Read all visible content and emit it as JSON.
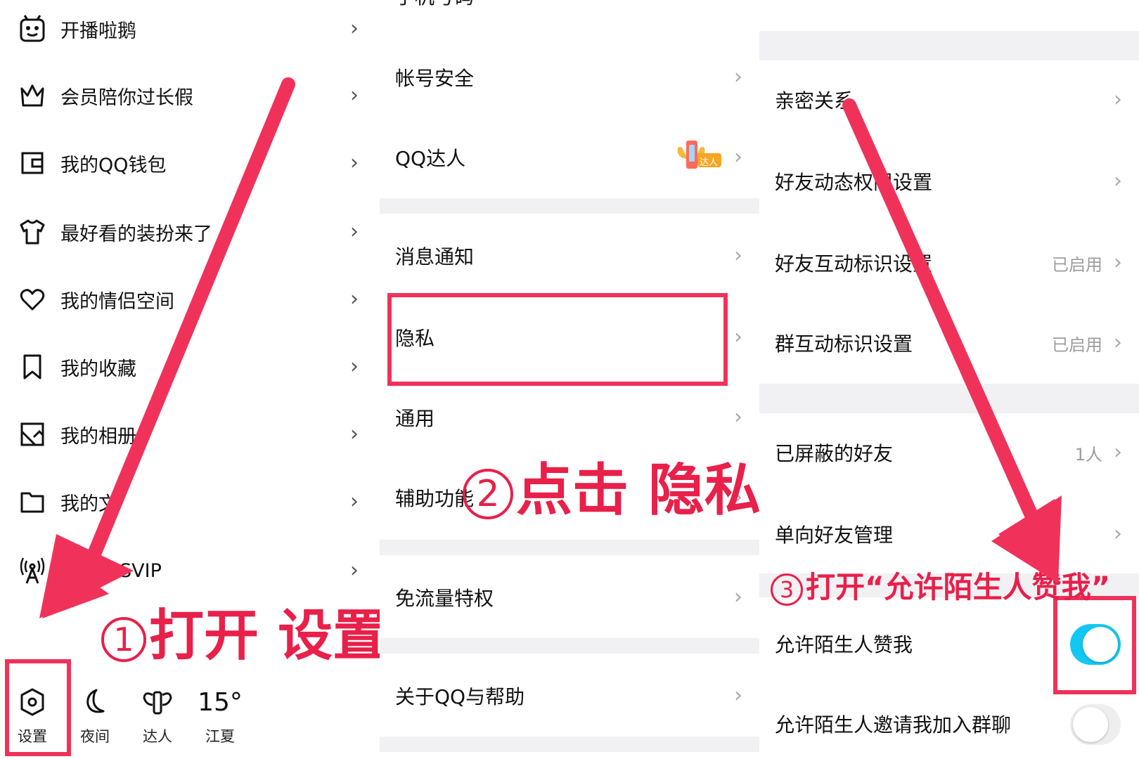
{
  "panel1": {
    "menu": [
      {
        "label": "开播啦鹅",
        "icon": "tv-mascot-icon"
      },
      {
        "label": "会员陪你过长假",
        "icon": "crown-icon"
      },
      {
        "label": "我的QQ钱包",
        "icon": "wallet-icon"
      },
      {
        "label": "最好看的装扮来了",
        "icon": "tshirt-icon"
      },
      {
        "label": "我的情侣空间",
        "icon": "heart-icon"
      },
      {
        "label": "我的收藏",
        "icon": "bookmark-icon"
      },
      {
        "label": "我的相册",
        "icon": "photo-icon"
      },
      {
        "label": "我的文",
        "icon": "folder-icon"
      },
      {
        "label": "SVIP",
        "icon": "broadcast-icon"
      }
    ],
    "bottom": [
      {
        "label": "设置",
        "icon": "settings-hex-icon"
      },
      {
        "label": "夜间",
        "icon": "moon-icon"
      },
      {
        "label": "达人",
        "icon": "wings-icon"
      },
      {
        "label": "江夏",
        "temp": "15°",
        "icon": "weather-text"
      }
    ],
    "annotation": {
      "num": "1",
      "text": "打开 设置"
    }
  },
  "panel2": {
    "top_cut_label": "手机号码",
    "rows": {
      "account_security": "帐号安全",
      "qq_talent": "QQ达人",
      "qq_talent_badge": "达人",
      "notifications": "消息通知",
      "privacy": "隐私",
      "general": "通用",
      "accessibility": "辅助功能",
      "free_data": "免流量特权",
      "about": "关于QQ与帮助"
    },
    "annotation": {
      "num": "2",
      "text": "点击 隐私"
    }
  },
  "panel3": {
    "rows": {
      "intimate": "亲密关系",
      "feed_permission": "好友动态权限设置",
      "friend_interaction": "好友互动标识设置",
      "friend_interaction_value": "已启用",
      "group_interaction": "群互动标识设置",
      "group_interaction_value": "已启用",
      "blocked": "已屏蔽的好友",
      "blocked_value": "1人",
      "one_way": "单向好友管理",
      "allow_like": "允许陌生人赞我",
      "allow_like_on": true,
      "allow_invite": "允许陌生人邀请我加入群聊",
      "allow_invite_on": false
    },
    "annotation": {
      "num": "3",
      "text": "打开“允许陌生人赞我”"
    }
  },
  "colors": {
    "accent_red": "#e8204a",
    "toggle_on": "#12c7f2",
    "toggle_off": "#eeeeee",
    "divider": "#f1f1f4"
  }
}
